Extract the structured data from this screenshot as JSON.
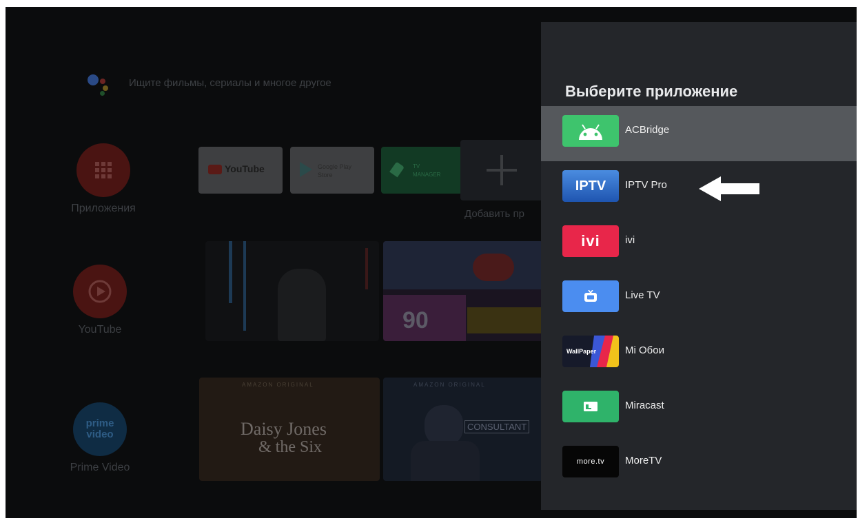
{
  "home": {
    "search_placeholder": "Ищите фильмы, сериалы и многое другое",
    "sidebar": [
      {
        "label": "Приложения"
      },
      {
        "label": "YouTube"
      },
      {
        "label": "Prime Video"
      }
    ],
    "prime_icon_text": "prime video",
    "favorites": {
      "youtube": "YouTube",
      "play_line1": "Google Play",
      "play_line2": "Store",
      "manager_line1": "TV",
      "manager_line2": "MANAGER",
      "add_label": "Добавить пр"
    },
    "posters": {
      "p1_tag": "AMAZON ORIGINAL",
      "p1_title_line1": "Daisy Jones",
      "p1_title_line2": "& the Six",
      "p2_tag": "AMAZON ORIGINAL",
      "p2_title": "CONSULTANT",
      "promo_number": "90"
    }
  },
  "panel": {
    "title": "Выберите приложение",
    "apps": [
      {
        "name": "ACBridge",
        "icon": "android-icon",
        "selected": true
      },
      {
        "name": "IPTV Pro",
        "icon": "iptv-icon",
        "icon_text": "IPTV"
      },
      {
        "name": "ivi",
        "icon": "ivi-icon",
        "icon_text": "ivi"
      },
      {
        "name": "Live TV",
        "icon": "tv-icon"
      },
      {
        "name": "Mi Обои",
        "icon": "wallpaper-icon",
        "icon_text": "WallPaper"
      },
      {
        "name": "Miracast",
        "icon": "cast-icon"
      },
      {
        "name": "MoreTV",
        "icon": "moretv-icon",
        "icon_text": "more.tv"
      }
    ]
  },
  "colors": {
    "panel_bg": "#24262a",
    "selected_row": "#55585c",
    "acbridge": "#3ec46d",
    "iptv": "#2f6fd0",
    "ivi": "#e8264a",
    "livetv": "#4b8df0",
    "miracast": "#2fb36a"
  }
}
